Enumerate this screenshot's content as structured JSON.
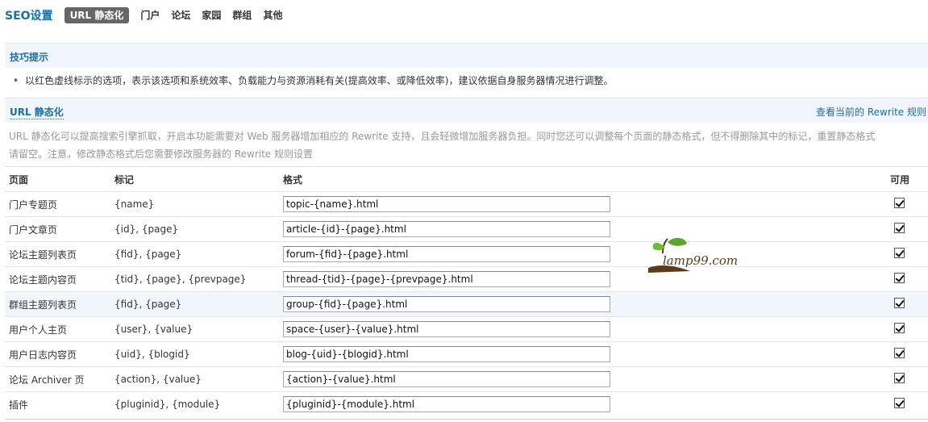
{
  "header": {
    "title": "SEO设置",
    "tabs": [
      {
        "label": "URL 静态化",
        "active": true
      },
      {
        "label": "门户"
      },
      {
        "label": "论坛"
      },
      {
        "label": "家园"
      },
      {
        "label": "群组"
      },
      {
        "label": "其他"
      }
    ]
  },
  "tips": {
    "heading": "技巧提示",
    "item": "以红色虚线标示的选项，表示该选项和系统效率、负载能力与资源消耗有关(提高效率、或降低效率)，建议依据自身服务器情况进行调整。"
  },
  "url_section": {
    "heading": "URL 静态化",
    "link": "查看当前的 Rewrite 规则",
    "description": "URL 静态化可以提高搜索引擎抓取，开启本功能需要对 Web 服务器增加相应的 Rewrite 支持，且会轻微增加服务器负担。同时您还可以调整每个页面的静态格式，但不得删除其中的标记，重置静态格式请留空。注意，修改静态格式后您需要修改服务器的 Rewrite 规则设置"
  },
  "table": {
    "headers": {
      "page": "页面",
      "marks": "标记",
      "format": "格式",
      "enabled": "可用"
    },
    "rows": [
      {
        "page": "门户专题页",
        "marks": "{name}",
        "format": "topic-{name}.html",
        "enabled": true
      },
      {
        "page": "门户文章页",
        "marks": "{id}, {page}",
        "format": "article-{id}-{page}.html",
        "enabled": true
      },
      {
        "page": "论坛主题列表页",
        "marks": "{fid}, {page}",
        "format": "forum-{fid}-{page}.html",
        "enabled": true
      },
      {
        "page": "论坛主题内容页",
        "marks": "{tid}, {page}, {prevpage}",
        "format": "thread-{tid}-{page}-{prevpage}.html",
        "enabled": true
      },
      {
        "page": "群组主题列表页",
        "marks": "{fid}, {page}",
        "format": "group-{fid}-{page}.html",
        "enabled": true
      },
      {
        "page": "用户个人主页",
        "marks": "{user}, {value}",
        "format": "space-{user}-{value}.html",
        "enabled": true
      },
      {
        "page": "用户日志内容页",
        "marks": "{uid}, {blogid}",
        "format": "blog-{uid}-{blogid}.html",
        "enabled": true
      },
      {
        "page": "论坛 Archiver 页",
        "marks": "{action}, {value}",
        "format": "{action}-{value}.html",
        "enabled": true
      },
      {
        "page": "插件",
        "marks": "{pluginid}, {module}",
        "format": "{pluginid}-{module}.html",
        "enabled": true
      }
    ]
  },
  "watermark": {
    "text": "lamp99.com",
    "icon": "leaf-sprout-icon"
  },
  "colors": {
    "accent": "#1a6ea6",
    "section_bg": "#f0f6fb",
    "active_tab": "#666666"
  }
}
